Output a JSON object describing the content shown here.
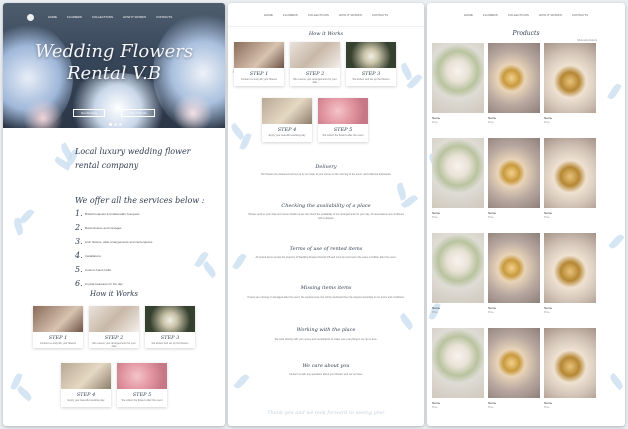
{
  "nav": {
    "items": [
      "Home",
      "Flowers",
      "Collections",
      "How it works",
      "Contacts"
    ]
  },
  "hero": {
    "title": "Wedding Flowers Rental V.B",
    "buttons": [
      "Our Flowers",
      "How it Works"
    ]
  },
  "intro": {
    "tagline": "Local luxury wedding flower rental company"
  },
  "services": {
    "title": "We offer all the services below :",
    "items": [
      {
        "num": "1.",
        "text": "Bridal bouquets & bridesmaids' bouquets"
      },
      {
        "num": "2.",
        "text": "Boutonnieres and corsages"
      },
      {
        "num": "3.",
        "text": "Arch flowers, aisle arrangements and centerpieces"
      },
      {
        "num": "4.",
        "text": "Installations"
      },
      {
        "num": "5.",
        "text": "Custom hand crafts"
      },
      {
        "num": "6.",
        "text": "Crystal treasures for the day"
      }
    ]
  },
  "how_it_works": {
    "title": "How it Works",
    "steps": [
      {
        "label": "STEP 1",
        "text": "Contact us and pick your flowers"
      },
      {
        "label": "STEP 2",
        "text": "We reserve your arrangements for your date"
      },
      {
        "label": "STEP 3",
        "text": "We deliver and set up the flowers"
      },
      {
        "label": "STEP 4",
        "text": "Enjoy your beautiful wedding day"
      },
      {
        "label": "STEP 5",
        "text": "We collect the flowers after the event"
      }
    ]
  },
  "info_sections": [
    {
      "title": "Delivery",
      "text": "Our flowers are delivered and set up by our team at your venue on the morning of the event, and collected afterwards."
    },
    {
      "title": "Checking the availability of a place",
      "text": "Please send us your date and venue details so we can check the availability of our arrangements for your day. All reservations are confirmed with a deposit."
    },
    {
      "title": "Terms of use of rented items",
      "text": "All rented items remain the property of Wedding Flowers Rental V.B and must be returned in the same condition after the event."
    },
    {
      "title": "Missing items items",
      "text": "If items are missing or damaged after the event, the replacement cost will be deducted from the deposit according to our terms and conditions."
    },
    {
      "title": "Working with the place",
      "text": "We work directly with your venue and coordinators to make sure everything is set up on time."
    },
    {
      "title": "We care about you",
      "text": "Contact us with any questions about your flowers and our services."
    }
  ],
  "thanks": "Thank you and we look forward to seeing you!",
  "products": {
    "title": "Products",
    "link": "Show all products",
    "items": [
      {
        "name": "Name",
        "price": "Price",
        "img": "bouquet"
      },
      {
        "name": "Name",
        "price": "Price",
        "img": "rings"
      },
      {
        "name": "Name",
        "price": "Price",
        "img": "rings2"
      },
      {
        "name": "Name",
        "price": "Price",
        "img": "bouquet"
      },
      {
        "name": "Name",
        "price": "Price",
        "img": "rings"
      },
      {
        "name": "Name",
        "price": "Price",
        "img": "rings2"
      },
      {
        "name": "Name",
        "price": "Price",
        "img": "bouquet"
      },
      {
        "name": "Name",
        "price": "Price",
        "img": "rings"
      },
      {
        "name": "Name",
        "price": "Price",
        "img": "rings2"
      },
      {
        "name": "Name",
        "price": "Price",
        "img": "bouquet"
      },
      {
        "name": "Name",
        "price": "Price",
        "img": "rings"
      },
      {
        "name": "Name",
        "price": "Price",
        "img": "rings2"
      }
    ]
  },
  "colors": {
    "accent": "#2f3b4c",
    "leaf": "#c7dcef",
    "hero_dark": "#2b3646"
  }
}
